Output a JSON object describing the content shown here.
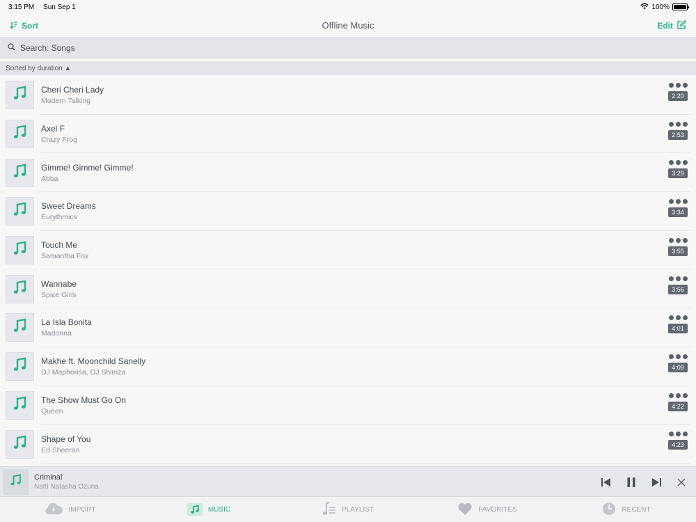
{
  "status": {
    "time": "3:15 PM",
    "date": "Sun Sep 1",
    "battery": "100%"
  },
  "nav": {
    "title": "Offline Music",
    "sort_label": "Sort",
    "edit_label": "Edit"
  },
  "search": {
    "placeholder": "Search: Songs"
  },
  "sort_header": {
    "label": "Sorted by duration ▲"
  },
  "songs": [
    {
      "title": "Cheri Cheri Lady",
      "artist": "Modern Talking",
      "duration": "2:20"
    },
    {
      "title": "Axel F",
      "artist": "Crazy Frog",
      "duration": "2:53"
    },
    {
      "title": "Gimme! Gimme! Gimme!",
      "artist": "Abba",
      "duration": "3:29"
    },
    {
      "title": "Sweet Dreams",
      "artist": "Eurythmics",
      "duration": "3:34"
    },
    {
      "title": "Touch Me",
      "artist": "Samantha Fox",
      "duration": "3:55"
    },
    {
      "title": "Wannabe",
      "artist": "Spice Girls",
      "duration": "3:56"
    },
    {
      "title": "La Isla Bonita",
      "artist": "Madonna",
      "duration": "4:01"
    },
    {
      "title": "Makhe ft. Moonchild Sanelly",
      "artist": "DJ Maphorisa, DJ Shimza",
      "duration": "4:09"
    },
    {
      "title": "The Show Must Go On",
      "artist": "Queen",
      "duration": "4:22"
    },
    {
      "title": "Shape of You",
      "artist": "Ed Sheeran",
      "duration": "4:23"
    }
  ],
  "player": {
    "title": "Criminal",
    "artist": "Natti Natasha Ozuna"
  },
  "tabs": [
    {
      "label": "IMPORT",
      "icon": "cloud-icon"
    },
    {
      "label": "MUSIC",
      "icon": "music-note-icon"
    },
    {
      "label": "PLAYLIST",
      "icon": "playlist-icon"
    },
    {
      "label": "FAVORITES",
      "icon": "heart-icon"
    },
    {
      "label": "RECENT",
      "icon": "clock-icon"
    }
  ],
  "colors": {
    "accent": "#2bb48a",
    "duration_badge": "#62686f"
  }
}
